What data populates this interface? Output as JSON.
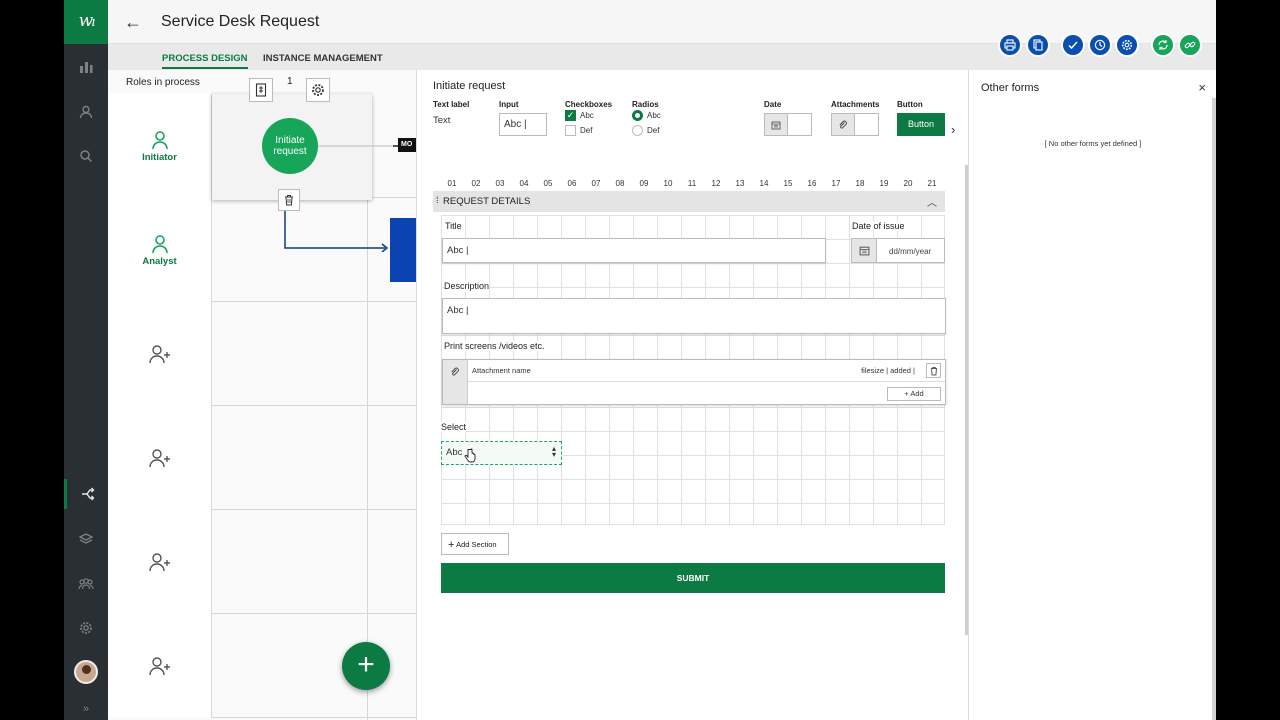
{
  "app": {
    "title": "Service Desk Request",
    "logo": "w"
  },
  "tabs": [
    {
      "label": "PROCESS DESIGN",
      "active": true
    },
    {
      "label": "INSTANCE MANAGEMENT",
      "active": false
    }
  ],
  "toolbar": {
    "icons": [
      "print-icon",
      "copy-icon",
      "check-icon",
      "clock-icon",
      "gear-icon",
      "refresh-icon",
      "link-icon"
    ]
  },
  "canvas": {
    "roles_header": "Roles in process",
    "step_count": "1",
    "step_label": "Initiate request",
    "connector_label": "MO",
    "roles": [
      {
        "label": "Initiator",
        "icon": "user-icon"
      },
      {
        "label": "Analyst",
        "icon": "user-icon"
      },
      {
        "label": "",
        "icon": "add-user-icon"
      },
      {
        "label": "",
        "icon": "add-user-icon"
      },
      {
        "label": "",
        "icon": "add-user-icon"
      },
      {
        "label": "",
        "icon": "add-user-icon"
      }
    ],
    "fab_label": "+"
  },
  "form": {
    "panel_title": "Initiate request",
    "palette": {
      "text_label": {
        "title": "Text label",
        "value": "Text"
      },
      "input": {
        "title": "Input",
        "value": "Abc |"
      },
      "checkboxes": {
        "title": "Checkboxes",
        "options": [
          "Abc",
          "Def"
        ]
      },
      "radios": {
        "title": "Radios",
        "options": [
          "Abc",
          "Def"
        ]
      },
      "date": {
        "title": "Date"
      },
      "attachments": {
        "title": "Attachments"
      },
      "button": {
        "title": "Button",
        "label": "Button"
      }
    },
    "columns": [
      "01",
      "02",
      "03",
      "04",
      "05",
      "06",
      "07",
      "08",
      "09",
      "10",
      "11",
      "12",
      "13",
      "14",
      "15",
      "16",
      "17",
      "18",
      "19",
      "20",
      "21"
    ],
    "section_title": "REQUEST DETAILS",
    "fields": {
      "title_label": "Title",
      "title_value": "Abc |",
      "date_label": "Date of issue",
      "date_placeholder": "dd/mm/year",
      "description_label": "Description",
      "description_value": "Abc |",
      "attach_label": "Print screens /videos etc.",
      "attach_name": "Attachment name",
      "attach_meta": "filesize  |  added  |",
      "attach_add": "+   Add",
      "select_label": "Select",
      "select_value": "Abc"
    },
    "add_section": "Add Section",
    "submit": "SUBMIT"
  },
  "other_forms": {
    "title": "Other forms",
    "empty": "[ No other forms yet defined ]",
    "close": "×"
  },
  "colors": {
    "brand_green": "#0c7a43",
    "step_green": "#17a559",
    "toolbar_blue": "#0a4fb0",
    "sidebar": "#2a2f33"
  }
}
